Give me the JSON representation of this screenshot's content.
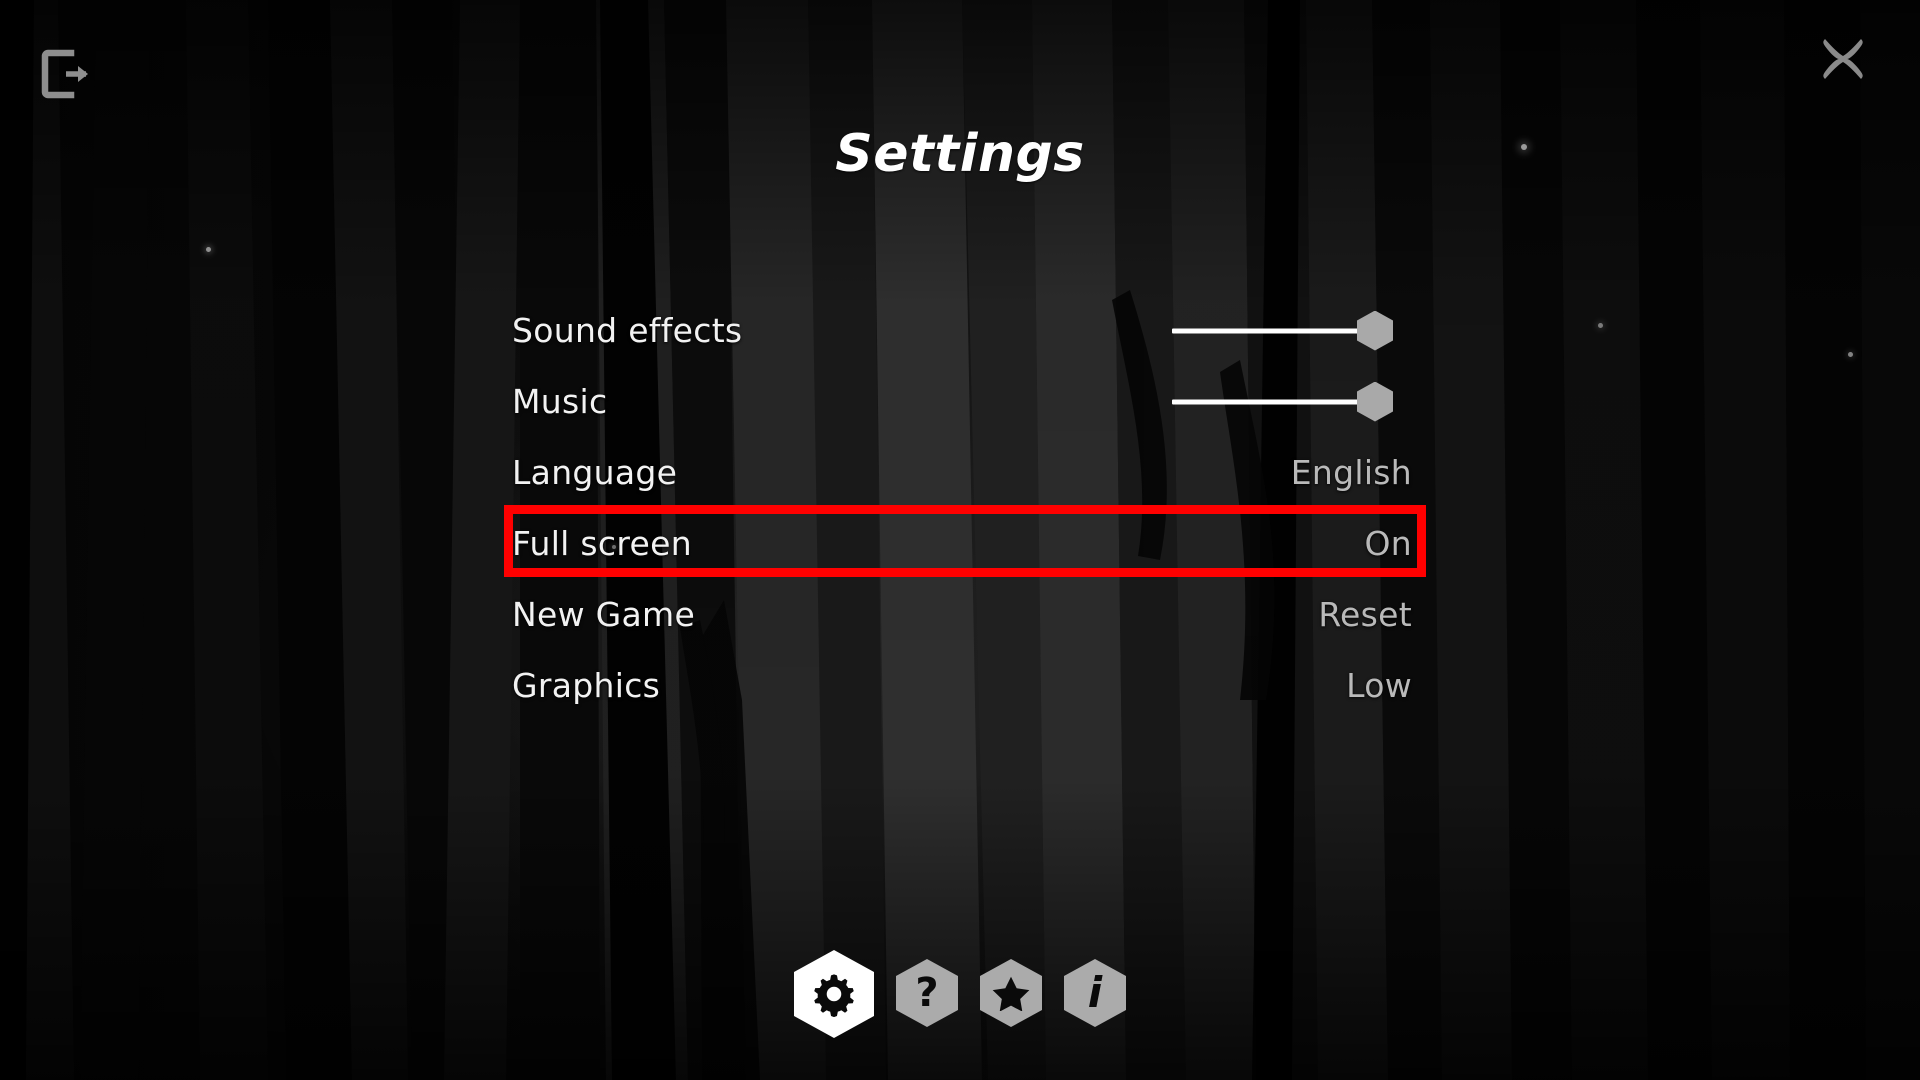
{
  "app": {
    "screen_title": "Settings",
    "background_theme": "dark-forest",
    "accent_highlight_color": "#ff0000",
    "label_color": "#f2f2f2",
    "value_color": "#b9b9b9",
    "slider_knob_color": "#a9a9a9",
    "active_nav_color": "#ffffff",
    "idle_nav_color": "#ababab"
  },
  "topbar": {
    "exit_icon": "exit-icon",
    "exit_label": "Exit",
    "close_icon": "close-icon",
    "close_label": "Close"
  },
  "settings": {
    "rows": [
      {
        "label": "Sound effects",
        "control": "slider",
        "value": "100",
        "value_text": ""
      },
      {
        "label": "Music",
        "control": "slider",
        "value": "100",
        "value_text": ""
      },
      {
        "label": "Language",
        "control": "value",
        "value": "English",
        "value_text": "English"
      },
      {
        "label": "Full screen",
        "control": "value",
        "value": "On",
        "value_text": "On"
      },
      {
        "label": "New Game",
        "control": "value",
        "value": "Reset",
        "value_text": "Reset"
      },
      {
        "label": "Graphics",
        "control": "value",
        "value": "Low",
        "value_text": "Low"
      }
    ],
    "highlighted_row_label": "Full screen"
  },
  "bottom_nav": {
    "items": [
      {
        "icon": "gear-icon",
        "label": "Settings",
        "glyph": "⚙",
        "state": "active"
      },
      {
        "icon": "question-icon",
        "label": "Help",
        "glyph": "?",
        "state": "idle"
      },
      {
        "icon": "star-icon",
        "label": "Rate",
        "glyph": "★",
        "state": "idle"
      },
      {
        "icon": "info-icon",
        "label": "About",
        "glyph": "i",
        "state": "idle"
      }
    ]
  }
}
